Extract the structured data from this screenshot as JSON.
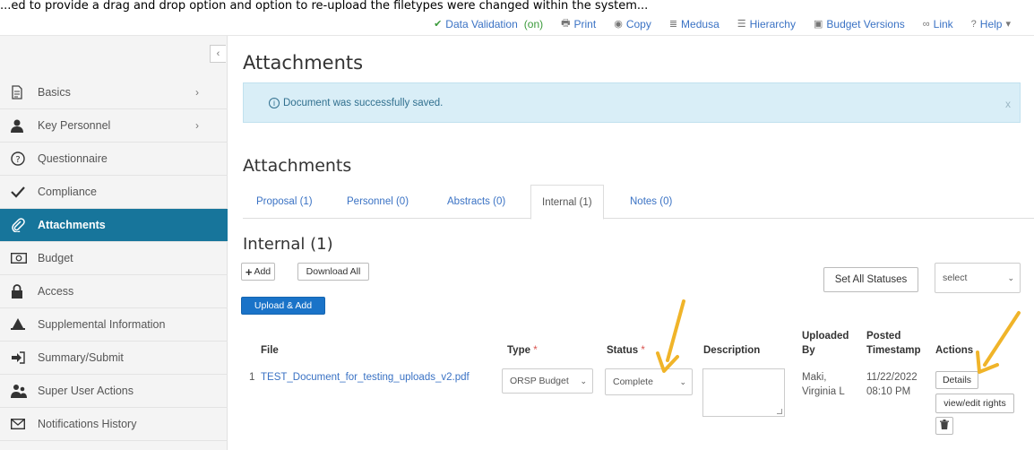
{
  "caption": "...ed to provide a drag and drop option and option to re-upload the filetypes were changed within the system...",
  "toolbar": {
    "data_validation": "Data Validation",
    "data_validation_state": "(on)",
    "print": "Print",
    "copy": "Copy",
    "medusa": "Medusa",
    "hierarchy": "Hierarchy",
    "budget_versions": "Budget Versions",
    "link": "Link",
    "help": "Help"
  },
  "sidebar": {
    "items": [
      {
        "label": "Basics",
        "icon": "document-icon",
        "chevron": "›"
      },
      {
        "label": "Key Personnel",
        "icon": "person-icon",
        "chevron": "›"
      },
      {
        "label": "Questionnaire",
        "icon": "question-icon"
      },
      {
        "label": "Compliance",
        "icon": "check-icon"
      },
      {
        "label": "Attachments",
        "icon": "paperclip-icon",
        "active": true
      },
      {
        "label": "Budget",
        "icon": "money-icon"
      },
      {
        "label": "Access",
        "icon": "lock-icon"
      },
      {
        "label": "Supplemental Information",
        "icon": "bell-icon"
      },
      {
        "label": "Summary/Submit",
        "icon": "signin-icon"
      },
      {
        "label": "Super User Actions",
        "icon": "users-icon"
      },
      {
        "label": "Notifications History",
        "icon": "envelope-icon"
      }
    ]
  },
  "main": {
    "title": "Attachments",
    "alert": "Document was successfully saved.",
    "alert_close": "x",
    "section_title": "Attachments",
    "tabs": [
      {
        "label": "Proposal (1)"
      },
      {
        "label": "Personnel (0)"
      },
      {
        "label": "Abstracts (0)"
      },
      {
        "label": "Internal (1)",
        "active": true
      },
      {
        "label": "Notes (0)"
      }
    ],
    "internal_title": "Internal (1)",
    "add_label": "Add",
    "download_all_label": "Download All",
    "upload_add_label": "Upload & Add",
    "set_all_statuses_label": "Set All Statuses",
    "status_select_value": "select",
    "table": {
      "headers": {
        "file": "File",
        "type": "Type",
        "status": "Status",
        "description": "Description",
        "uploaded_by_1": "Uploaded",
        "uploaded_by_2": "By",
        "posted_1": "Posted",
        "posted_2": "Timestamp",
        "actions": "Actions",
        "required_mark": "*"
      },
      "rows": [
        {
          "index": "1",
          "file": "TEST_Document_for_testing_uploads_v2.pdf",
          "type": "ORSP Budget",
          "status": "Complete",
          "uploaded_by_1": "Maki,",
          "uploaded_by_2": "Virginia L",
          "posted_date": "11/22/2022",
          "posted_time": "08:10 PM",
          "details_label": "Details",
          "rights_label": "view/edit rights"
        }
      ]
    }
  },
  "colors": {
    "accent": "#17759b",
    "link": "#3a72c4",
    "primary_button": "#1a73c8",
    "alert_bg": "#d9eef7",
    "annotation_arrow": "#f0b429"
  }
}
